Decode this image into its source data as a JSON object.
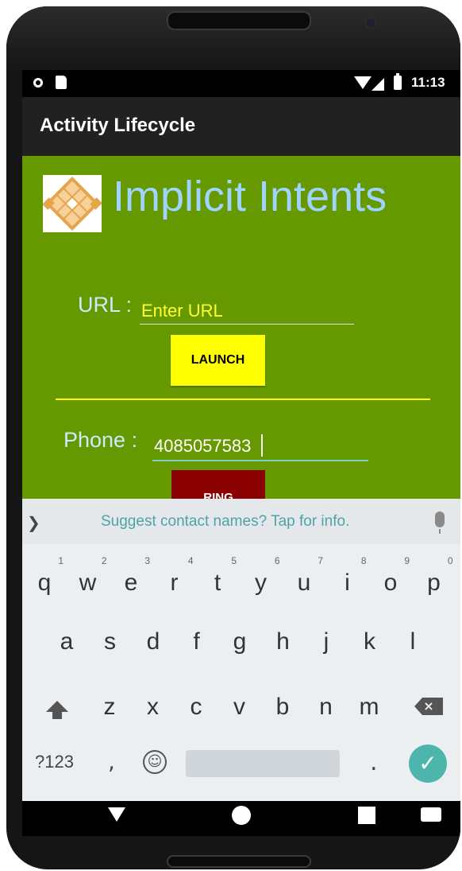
{
  "statusbar": {
    "time": "11:13"
  },
  "appbar": {
    "title": "Activity Lifecycle"
  },
  "content": {
    "title": "Implicit Intents",
    "url_label": "URL :",
    "url_placeholder": "Enter URL",
    "launch_label": "LAUNCH",
    "phone_label": "Phone :",
    "phone_value": "4085057583",
    "ring_label": "RING"
  },
  "keyboard": {
    "suggestion": "Suggest contact names? Tap for info.",
    "row1": [
      "q",
      "w",
      "e",
      "r",
      "t",
      "y",
      "u",
      "i",
      "o",
      "p"
    ],
    "row1_hints": [
      "1",
      "2",
      "3",
      "4",
      "5",
      "6",
      "7",
      "8",
      "9",
      "0"
    ],
    "row2": [
      "a",
      "s",
      "d",
      "f",
      "g",
      "h",
      "j",
      "k",
      "l"
    ],
    "row3": [
      "z",
      "x",
      "c",
      "v",
      "b",
      "n",
      "m"
    ],
    "symbols_label": "?123",
    "comma_label": ",",
    "period_label": "."
  },
  "colors": {
    "content_bg": "#669900",
    "title": "#9fd4ff",
    "launch_button": "#ffff00",
    "ring_button": "#8b0000",
    "accent": "#4db6ac"
  }
}
